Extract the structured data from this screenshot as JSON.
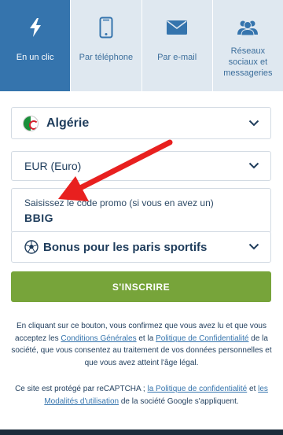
{
  "tabs": [
    {
      "label": "En un clic",
      "icon": "lightning-icon",
      "active": true
    },
    {
      "label": "Par téléphone",
      "icon": "phone-icon",
      "active": false
    },
    {
      "label": "Par e-mail",
      "icon": "envelope-icon",
      "active": false
    },
    {
      "label": "Réseaux sociaux et messageries",
      "icon": "users-icon",
      "active": false
    }
  ],
  "form": {
    "country": {
      "value": "Algérie",
      "icon": "algeria-flag-icon"
    },
    "currency": {
      "value": "EUR (Euro)"
    },
    "promo": {
      "placeholder": "Saisissez le code promo (si vous en avez un)",
      "value": "BBIG"
    },
    "bonus": {
      "value": "Bonus pour les paris sportifs",
      "icon": "soccer-ball-icon"
    },
    "submit_label": "S'INSCRIRE"
  },
  "legal": {
    "p1_part1": "En cliquant sur ce bouton, vous confirmez que vous avez lu et que vous acceptez les ",
    "p1_link1": "Conditions Générales",
    "p1_part2": " et la ",
    "p1_link2": "Politique de Confidentialité",
    "p1_part3": " de la société, que vous consentez au traitement de vos données personnelles et que vous avez atteint l'âge légal.",
    "p2_part1": "Ce site est protégé par reCAPTCHA ; ",
    "p2_link1": "la Politique de confidentialité",
    "p2_part2": " et ",
    "p2_link2": "les Modalités d'utilisation",
    "p2_part3": " de la société Google s'appliquent."
  },
  "colors": {
    "tab_active": "#3574ad",
    "tab_bg": "#dfe8f0",
    "button": "#77a43a",
    "annotation_arrow": "#e8201f"
  }
}
